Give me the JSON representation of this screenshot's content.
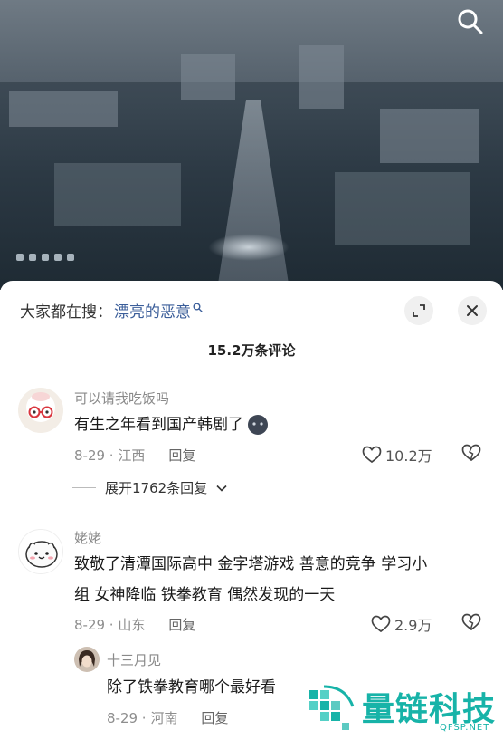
{
  "video": {
    "search_icon": "search-icon"
  },
  "sheet": {
    "suggest_prefix": "大家都在搜：",
    "suggest_keyword": "漂亮的恶意",
    "expand_icon": "expand-icon",
    "close_icon": "close-icon",
    "comment_count": "15.2万条评论"
  },
  "comments": [
    {
      "username": "可以请我吃饭吗",
      "text": "有生之年看到国产韩剧了",
      "date_location": "8-29 · 江西",
      "reply_label": "回复",
      "likes": "10.2万",
      "expand_label": "展开1762条回复"
    },
    {
      "username": "姥姥",
      "text_line1": "致敬了清潭国际高中 金字塔游戏 善意的竞争 学习小",
      "text_line2": "组 女神降临 铁拳教育 偶然发现的一天",
      "date_location": "8-29 · 山东",
      "reply_label": "回复",
      "likes": "2.9万"
    },
    {
      "username": "十三月见",
      "text": "除了铁拳教育哪个最好看",
      "date_location": "8-29 · 河南",
      "reply_label": "回复"
    }
  ],
  "watermark": {
    "brand": "量链科技",
    "site": "QFSP.NET"
  }
}
